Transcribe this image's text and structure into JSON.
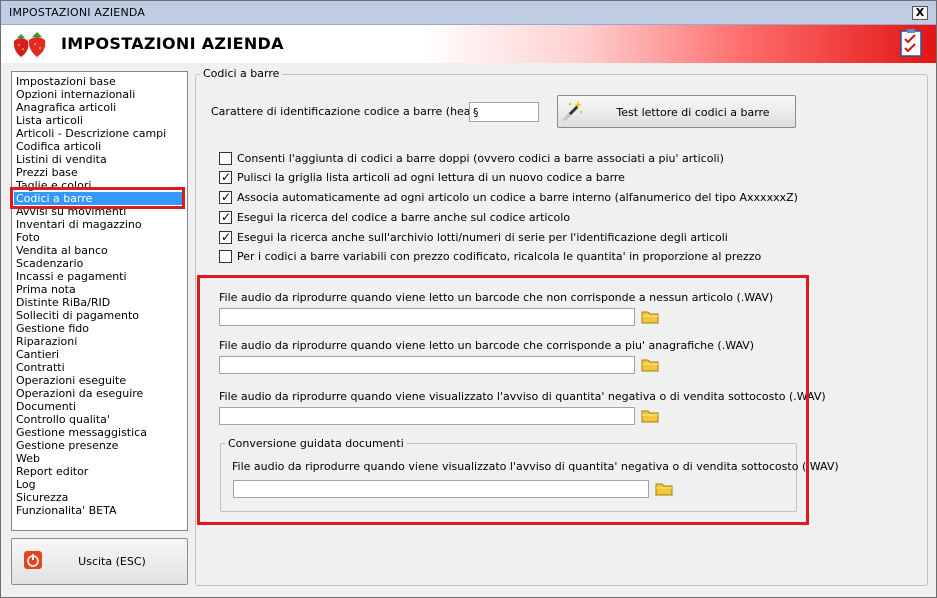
{
  "window": {
    "title": "IMPOSTAZIONI AZIENDA",
    "close_label": "X"
  },
  "header": {
    "title": "IMPOSTAZIONI AZIENDA"
  },
  "sidebar": {
    "items": [
      {
        "label": "Impostazioni base"
      },
      {
        "label": "Opzioni internazionali"
      },
      {
        "label": "Anagrafica articoli"
      },
      {
        "label": "Lista articoli"
      },
      {
        "label": "Articoli - Descrizione campi"
      },
      {
        "label": "Codifica articoli"
      },
      {
        "label": "Listini di vendita"
      },
      {
        "label": "Prezzi base"
      },
      {
        "label": "Taglie e colori"
      },
      {
        "label": "Codici a barre",
        "selected": true
      },
      {
        "label": "Avvisi su movimenti"
      },
      {
        "label": "Inventari di magazzino"
      },
      {
        "label": "Foto"
      },
      {
        "label": "Vendita al banco"
      },
      {
        "label": "Scadenzario"
      },
      {
        "label": "Incassi e pagamenti"
      },
      {
        "label": "Prima nota"
      },
      {
        "label": "Distinte RiBa/RID"
      },
      {
        "label": "Solleciti di pagamento"
      },
      {
        "label": "Gestione fido"
      },
      {
        "label": "Riparazioni"
      },
      {
        "label": "Cantieri"
      },
      {
        "label": "Contratti"
      },
      {
        "label": "Operazioni eseguite"
      },
      {
        "label": "Operazioni da eseguire"
      },
      {
        "label": "Documenti"
      },
      {
        "label": "Controllo qualita'"
      },
      {
        "label": "Gestione messaggistica"
      },
      {
        "label": "Gestione presenze"
      },
      {
        "label": "Web"
      },
      {
        "label": "Report editor"
      },
      {
        "label": "Log"
      },
      {
        "label": "Sicurezza"
      },
      {
        "label": "Funzionalita' BETA"
      }
    ]
  },
  "exit_button": {
    "label": "Uscita (ESC)"
  },
  "barcode": {
    "group_title": "Codici a barre",
    "header_label": "Carattere di identificazione codice a barre (header) :",
    "header_value": "§",
    "test_button_label": "Test lettore di codici a barre",
    "options": [
      {
        "label": "Consenti l'aggiunta di codici a barre doppi (ovvero codici a barre associati a piu' articoli)",
        "checked": false
      },
      {
        "label": "Pulisci la griglia lista articoli ad ogni lettura di un nuovo codice a barre",
        "checked": true
      },
      {
        "label": "Associa automaticamente ad ogni articolo un codice a barre interno (alfanumerico del tipo AxxxxxxZ)",
        "checked": true
      },
      {
        "label": "Esegui la ricerca del codice a barre anche sul codice articolo",
        "checked": true
      },
      {
        "label": "Esegui la ricerca anche sull'archivio lotti/numeri di serie per l'identificazione degli articoli",
        "checked": true
      },
      {
        "label": "Per i codici a barre variabili con prezzo codificato, ricalcola le quantita' in proporzione al prezzo",
        "checked": false
      }
    ]
  },
  "audio": {
    "files": [
      {
        "label": "File audio da riprodurre quando viene letto un barcode che non corrisponde a nessun articolo (.WAV)",
        "value": ""
      },
      {
        "label": "File audio da riprodurre quando viene letto un barcode che corrisponde a piu' anagrafiche (.WAV)",
        "value": ""
      },
      {
        "label": "File audio da riprodurre quando viene visualizzato l'avviso di quantita' negativa o di vendita sottocosto (.WAV)",
        "value": ""
      }
    ],
    "conversion": {
      "group_title": "Conversione guidata documenti",
      "label": "File audio da riprodurre quando viene visualizzato l'avviso di quantita' negativa o di vendita sottocosto (.WAV)",
      "value": ""
    }
  },
  "colors": {
    "highlight_frame": "#e01a1a",
    "selection": "#3399ff",
    "header_accent": "#e31414"
  }
}
